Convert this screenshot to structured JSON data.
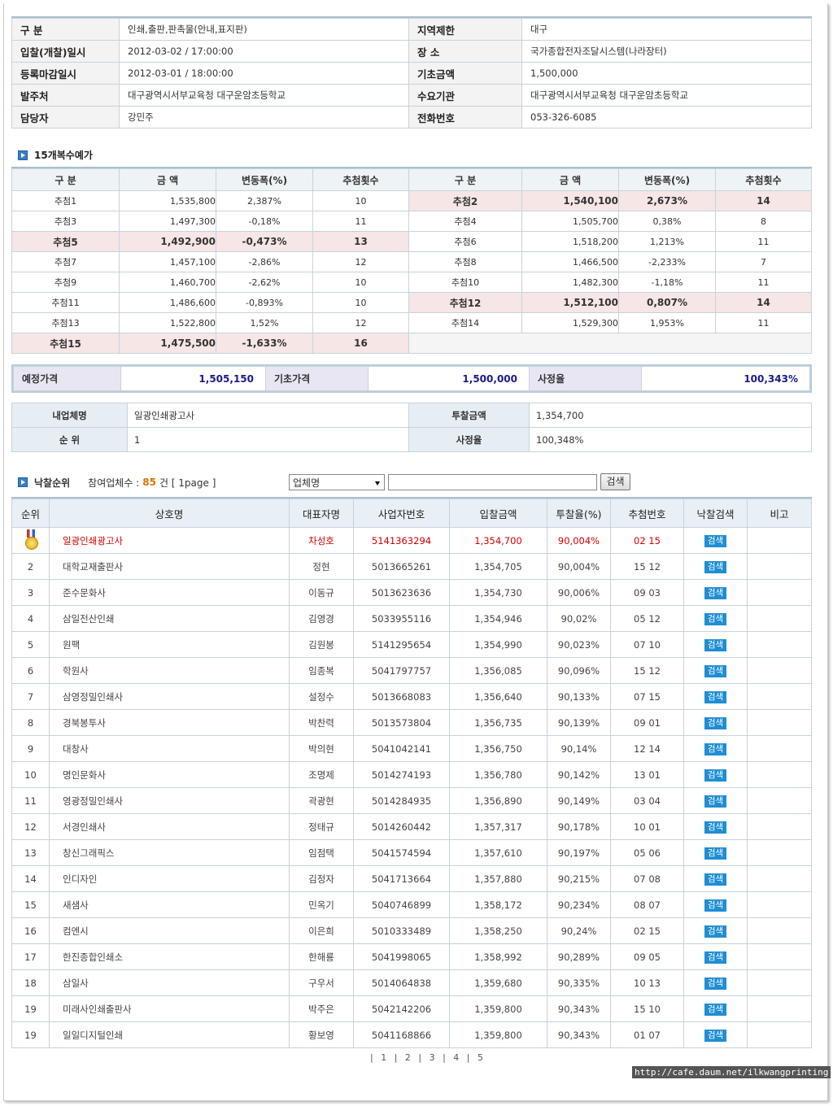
{
  "info": {
    "rows": [
      {
        "l1": "구 분",
        "v1": "인쇄,출판,판촉물(안내,표지판)",
        "l2": "지역제한",
        "v2": "대구"
      },
      {
        "l1": "입찰(개찰)일시",
        "v1": "2012-03-02 / 17:00:00",
        "l2": "장 소",
        "v2": "국가종합전자조달시스템(나라장터)"
      },
      {
        "l1": "등록마감일시",
        "v1": "2012-03-01 / 18:00:00",
        "l2": "기초금액",
        "v2": "1,500,000"
      },
      {
        "l1": "발주처",
        "v1": "대구광역시서부교육청 대구운암초등학교",
        "l2": "수요기관",
        "v2": "대구광역시서부교육청 대구운암초등학교"
      },
      {
        "l1": "담당자",
        "v1": "강민주",
        "l2": "전화번호",
        "v2": "053-326-6085"
      }
    ]
  },
  "prices": {
    "section_title": "15개복수예가",
    "headers": [
      "구 분",
      "금 액",
      "변동폭(%)",
      "추첨횟수",
      "구 분",
      "금 액",
      "변동폭(%)",
      "추첨횟수"
    ],
    "rows": [
      [
        {
          "n": "추첨1",
          "a": "1,535,800",
          "p": "2,387%",
          "c": "10",
          "h": false
        },
        {
          "n": "추첨2",
          "a": "1,540,100",
          "p": "2,673%",
          "c": "14",
          "h": true
        }
      ],
      [
        {
          "n": "추첨3",
          "a": "1,497,300",
          "p": "-0,18%",
          "c": "11",
          "h": false
        },
        {
          "n": "추첨4",
          "a": "1,505,700",
          "p": "0,38%",
          "c": "8",
          "h": false
        }
      ],
      [
        {
          "n": "추첨5",
          "a": "1,492,900",
          "p": "-0,473%",
          "c": "13",
          "h": true
        },
        {
          "n": "추첨6",
          "a": "1,518,200",
          "p": "1,213%",
          "c": "11",
          "h": false
        }
      ],
      [
        {
          "n": "추첨7",
          "a": "1,457,100",
          "p": "-2,86%",
          "c": "12",
          "h": false
        },
        {
          "n": "추첨8",
          "a": "1,466,500",
          "p": "-2,233%",
          "c": "7",
          "h": false
        }
      ],
      [
        {
          "n": "추첨9",
          "a": "1,460,700",
          "p": "-2,62%",
          "c": "10",
          "h": false
        },
        {
          "n": "추첨10",
          "a": "1,482,300",
          "p": "-1,18%",
          "c": "11",
          "h": false
        }
      ],
      [
        {
          "n": "추첨11",
          "a": "1,486,600",
          "p": "-0,893%",
          "c": "10",
          "h": false
        },
        {
          "n": "추첨12",
          "a": "1,512,100",
          "p": "0,807%",
          "c": "14",
          "h": true
        }
      ],
      [
        {
          "n": "추첨13",
          "a": "1,522,800",
          "p": "1,52%",
          "c": "12",
          "h": false
        },
        {
          "n": "추첨14",
          "a": "1,529,300",
          "p": "1,953%",
          "c": "11",
          "h": false
        }
      ],
      [
        {
          "n": "추첨15",
          "a": "1,475,500",
          "p": "-1,633%",
          "c": "16",
          "h": true
        },
        null
      ]
    ]
  },
  "summary": {
    "expected_label": "예정가격",
    "expected_value": "1,505,150",
    "base_label": "기초가격",
    "base_value": "1,500,000",
    "rate_label": "사정율",
    "rate_value": "100,343%"
  },
  "company": {
    "name_label": "내업체명",
    "name_value": "일광인쇄광고사",
    "bid_label": "투찰금액",
    "bid_value": "1,354,700",
    "rank_label": "순 위",
    "rank_value": "1",
    "rate_label": "사정율",
    "rate_value": "100,348%"
  },
  "ranking_bar": {
    "title": "낙찰순위",
    "participants_label": "참여업체수 :",
    "participants_count": "85",
    "participants_suffix": "건 [ 1page ]",
    "select_value": "업체명",
    "search_button": "검색"
  },
  "ranking": {
    "headers": [
      "순위",
      "상호명",
      "대표자명",
      "사업자번호",
      "입찰금액",
      "투찰율(%)",
      "추첨번호",
      "낙찰검색",
      "비고"
    ],
    "search_label": "검색",
    "rows": [
      {
        "rank": "",
        "medal": true,
        "name": "일광인쇄광고사",
        "ceo": "차성호",
        "biz": "5141363294",
        "amount": "1,354,700",
        "rate": "90,004%",
        "draw": "02 15"
      },
      {
        "rank": "2",
        "name": "대학교재출판사",
        "ceo": "정현",
        "biz": "5013665261",
        "amount": "1,354,705",
        "rate": "90,004%",
        "draw": "15 12"
      },
      {
        "rank": "3",
        "name": "준수문화사",
        "ceo": "이동규",
        "biz": "5013623636",
        "amount": "1,354,730",
        "rate": "90,006%",
        "draw": "09 03"
      },
      {
        "rank": "4",
        "name": "삼일전산인쇄",
        "ceo": "김영경",
        "biz": "5033955116",
        "amount": "1,354,946",
        "rate": "90,02%",
        "draw": "05 12"
      },
      {
        "rank": "5",
        "name": "원팩",
        "ceo": "김원봉",
        "biz": "5141295654",
        "amount": "1,354,990",
        "rate": "90,023%",
        "draw": "07 10"
      },
      {
        "rank": "6",
        "name": "학원사",
        "ceo": "임종복",
        "biz": "5041797757",
        "amount": "1,356,085",
        "rate": "90,096%",
        "draw": "15 12"
      },
      {
        "rank": "7",
        "name": "삼영정밀인쇄사",
        "ceo": "설정수",
        "biz": "5013668083",
        "amount": "1,356,640",
        "rate": "90,133%",
        "draw": "07 15"
      },
      {
        "rank": "8",
        "name": "경북봉투사",
        "ceo": "박찬력",
        "biz": "5013573804",
        "amount": "1,356,735",
        "rate": "90,139%",
        "draw": "09 01"
      },
      {
        "rank": "9",
        "name": "대창사",
        "ceo": "박의현",
        "biz": "5041042141",
        "amount": "1,356,750",
        "rate": "90,14%",
        "draw": "12 14"
      },
      {
        "rank": "10",
        "name": "명인문화사",
        "ceo": "조명제",
        "biz": "5014274193",
        "amount": "1,356,780",
        "rate": "90,142%",
        "draw": "13 01"
      },
      {
        "rank": "11",
        "name": "영광정밀인쇄사",
        "ceo": "곽광현",
        "biz": "5014284935",
        "amount": "1,356,890",
        "rate": "90,149%",
        "draw": "03 04"
      },
      {
        "rank": "12",
        "name": "서경인쇄사",
        "ceo": "정태규",
        "biz": "5014260442",
        "amount": "1,357,317",
        "rate": "90,178%",
        "draw": "10 01"
      },
      {
        "rank": "13",
        "name": "창신그래픽스",
        "ceo": "임점택",
        "biz": "5041574594",
        "amount": "1,357,610",
        "rate": "90,197%",
        "draw": "05 06"
      },
      {
        "rank": "14",
        "name": "인디자인",
        "ceo": "김정자",
        "biz": "5041713664",
        "amount": "1,357,880",
        "rate": "90,215%",
        "draw": "07 08"
      },
      {
        "rank": "15",
        "name": "새샘사",
        "ceo": "민옥기",
        "biz": "5040746899",
        "amount": "1,358,172",
        "rate": "90,234%",
        "draw": "08 07"
      },
      {
        "rank": "16",
        "name": "컴엔시",
        "ceo": "이은희",
        "biz": "5010333489",
        "amount": "1,358,250",
        "rate": "90,24%",
        "draw": "02 15"
      },
      {
        "rank": "17",
        "name": "한진종합인쇄소",
        "ceo": "한해룡",
        "biz": "5041998065",
        "amount": "1,358,992",
        "rate": "90,289%",
        "draw": "09 05"
      },
      {
        "rank": "18",
        "name": "삼일사",
        "ceo": "구우서",
        "biz": "5014064838",
        "amount": "1,359,680",
        "rate": "90,335%",
        "draw": "10 13"
      },
      {
        "rank": "19",
        "name": "미래사인쇄출판사",
        "ceo": "박주은",
        "biz": "5042142206",
        "amount": "1,359,800",
        "rate": "90,343%",
        "draw": "15 10"
      },
      {
        "rank": "19",
        "name": "일일디지털인쇄",
        "ceo": "황보영",
        "biz": "5041168866",
        "amount": "1,359,800",
        "rate": "90,343%",
        "draw": "01 07"
      }
    ]
  },
  "pager": "| 1 | 2 | 3 | 4 | 5",
  "watermark": "http://cafe.daum.net/ilkwangprinting"
}
